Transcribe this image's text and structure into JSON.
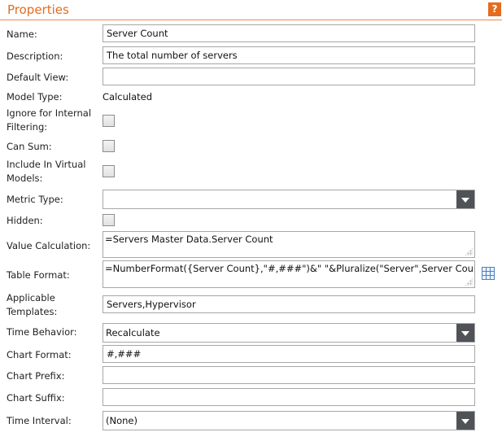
{
  "header": {
    "title": "Properties",
    "help_label": "?"
  },
  "fields": {
    "name": {
      "label": "Name:",
      "value": "Server Count"
    },
    "description": {
      "label": "Description:",
      "value": "The total number of servers"
    },
    "default_view": {
      "label": "Default View:",
      "value": ""
    },
    "model_type": {
      "label": "Model Type:",
      "value": "Calculated"
    },
    "ignore_filtering": {
      "label": "Ignore for Internal Filtering:",
      "checked": false
    },
    "can_sum": {
      "label": "Can Sum:",
      "checked": false
    },
    "include_virtual": {
      "label": "Include In Virtual Models:",
      "checked": false
    },
    "metric_type": {
      "label": "Metric Type:",
      "value": ""
    },
    "hidden": {
      "label": "Hidden:",
      "checked": false
    },
    "value_calculation": {
      "label": "Value Calculation:",
      "value": "=Servers Master Data.Server Count"
    },
    "table_format": {
      "label": "Table Format:",
      "value": "=NumberFormat({Server Count},\"#,###\")&\" \"&Pluralize(\"Server\",Server Count)"
    },
    "applicable_templates": {
      "label": "Applicable Templates:",
      "value": "Servers,Hypervisor"
    },
    "time_behavior": {
      "label": "Time Behavior:",
      "value": "Recalculate"
    },
    "chart_format": {
      "label": "Chart Format:",
      "value": "#,###"
    },
    "chart_prefix": {
      "label": "Chart Prefix:",
      "value": ""
    },
    "chart_suffix": {
      "label": "Chart Suffix:",
      "value": ""
    },
    "time_interval": {
      "label": "Time Interval:",
      "value": "(None)"
    }
  },
  "icons": {
    "help": "help-icon",
    "table_format_picker": "grid-icon"
  },
  "colors": {
    "accent": "#e46c1e",
    "dropdown_button": "#4f5357",
    "border": "#a7a7a7"
  }
}
